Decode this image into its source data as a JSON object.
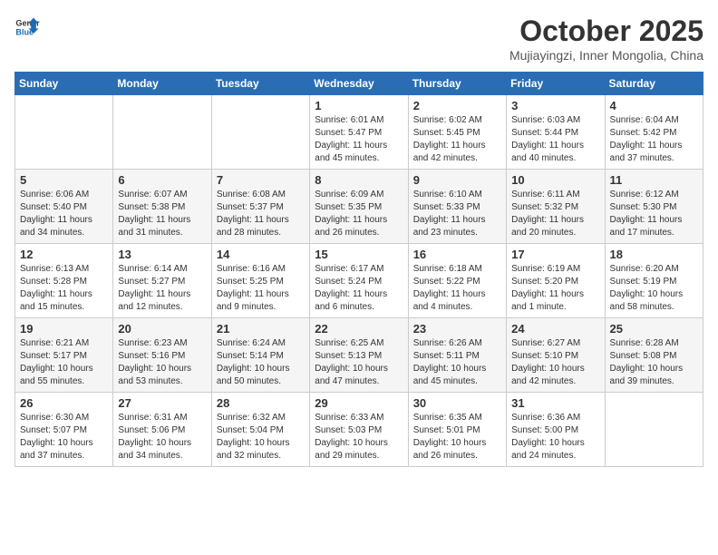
{
  "header": {
    "logo_general": "General",
    "logo_blue": "Blue",
    "month": "October 2025",
    "location": "Mujiayingzi, Inner Mongolia, China"
  },
  "days_of_week": [
    "Sunday",
    "Monday",
    "Tuesday",
    "Wednesday",
    "Thursday",
    "Friday",
    "Saturday"
  ],
  "weeks": [
    [
      {
        "day": "",
        "text": ""
      },
      {
        "day": "",
        "text": ""
      },
      {
        "day": "",
        "text": ""
      },
      {
        "day": "1",
        "text": "Sunrise: 6:01 AM\nSunset: 5:47 PM\nDaylight: 11 hours\nand 45 minutes."
      },
      {
        "day": "2",
        "text": "Sunrise: 6:02 AM\nSunset: 5:45 PM\nDaylight: 11 hours\nand 42 minutes."
      },
      {
        "day": "3",
        "text": "Sunrise: 6:03 AM\nSunset: 5:44 PM\nDaylight: 11 hours\nand 40 minutes."
      },
      {
        "day": "4",
        "text": "Sunrise: 6:04 AM\nSunset: 5:42 PM\nDaylight: 11 hours\nand 37 minutes."
      }
    ],
    [
      {
        "day": "5",
        "text": "Sunrise: 6:06 AM\nSunset: 5:40 PM\nDaylight: 11 hours\nand 34 minutes."
      },
      {
        "day": "6",
        "text": "Sunrise: 6:07 AM\nSunset: 5:38 PM\nDaylight: 11 hours\nand 31 minutes."
      },
      {
        "day": "7",
        "text": "Sunrise: 6:08 AM\nSunset: 5:37 PM\nDaylight: 11 hours\nand 28 minutes."
      },
      {
        "day": "8",
        "text": "Sunrise: 6:09 AM\nSunset: 5:35 PM\nDaylight: 11 hours\nand 26 minutes."
      },
      {
        "day": "9",
        "text": "Sunrise: 6:10 AM\nSunset: 5:33 PM\nDaylight: 11 hours\nand 23 minutes."
      },
      {
        "day": "10",
        "text": "Sunrise: 6:11 AM\nSunset: 5:32 PM\nDaylight: 11 hours\nand 20 minutes."
      },
      {
        "day": "11",
        "text": "Sunrise: 6:12 AM\nSunset: 5:30 PM\nDaylight: 11 hours\nand 17 minutes."
      }
    ],
    [
      {
        "day": "12",
        "text": "Sunrise: 6:13 AM\nSunset: 5:28 PM\nDaylight: 11 hours\nand 15 minutes."
      },
      {
        "day": "13",
        "text": "Sunrise: 6:14 AM\nSunset: 5:27 PM\nDaylight: 11 hours\nand 12 minutes."
      },
      {
        "day": "14",
        "text": "Sunrise: 6:16 AM\nSunset: 5:25 PM\nDaylight: 11 hours\nand 9 minutes."
      },
      {
        "day": "15",
        "text": "Sunrise: 6:17 AM\nSunset: 5:24 PM\nDaylight: 11 hours\nand 6 minutes."
      },
      {
        "day": "16",
        "text": "Sunrise: 6:18 AM\nSunset: 5:22 PM\nDaylight: 11 hours\nand 4 minutes."
      },
      {
        "day": "17",
        "text": "Sunrise: 6:19 AM\nSunset: 5:20 PM\nDaylight: 11 hours\nand 1 minute."
      },
      {
        "day": "18",
        "text": "Sunrise: 6:20 AM\nSunset: 5:19 PM\nDaylight: 10 hours\nand 58 minutes."
      }
    ],
    [
      {
        "day": "19",
        "text": "Sunrise: 6:21 AM\nSunset: 5:17 PM\nDaylight: 10 hours\nand 55 minutes."
      },
      {
        "day": "20",
        "text": "Sunrise: 6:23 AM\nSunset: 5:16 PM\nDaylight: 10 hours\nand 53 minutes."
      },
      {
        "day": "21",
        "text": "Sunrise: 6:24 AM\nSunset: 5:14 PM\nDaylight: 10 hours\nand 50 minutes."
      },
      {
        "day": "22",
        "text": "Sunrise: 6:25 AM\nSunset: 5:13 PM\nDaylight: 10 hours\nand 47 minutes."
      },
      {
        "day": "23",
        "text": "Sunrise: 6:26 AM\nSunset: 5:11 PM\nDaylight: 10 hours\nand 45 minutes."
      },
      {
        "day": "24",
        "text": "Sunrise: 6:27 AM\nSunset: 5:10 PM\nDaylight: 10 hours\nand 42 minutes."
      },
      {
        "day": "25",
        "text": "Sunrise: 6:28 AM\nSunset: 5:08 PM\nDaylight: 10 hours\nand 39 minutes."
      }
    ],
    [
      {
        "day": "26",
        "text": "Sunrise: 6:30 AM\nSunset: 5:07 PM\nDaylight: 10 hours\nand 37 minutes."
      },
      {
        "day": "27",
        "text": "Sunrise: 6:31 AM\nSunset: 5:06 PM\nDaylight: 10 hours\nand 34 minutes."
      },
      {
        "day": "28",
        "text": "Sunrise: 6:32 AM\nSunset: 5:04 PM\nDaylight: 10 hours\nand 32 minutes."
      },
      {
        "day": "29",
        "text": "Sunrise: 6:33 AM\nSunset: 5:03 PM\nDaylight: 10 hours\nand 29 minutes."
      },
      {
        "day": "30",
        "text": "Sunrise: 6:35 AM\nSunset: 5:01 PM\nDaylight: 10 hours\nand 26 minutes."
      },
      {
        "day": "31",
        "text": "Sunrise: 6:36 AM\nSunset: 5:00 PM\nDaylight: 10 hours\nand 24 minutes."
      },
      {
        "day": "",
        "text": ""
      }
    ]
  ]
}
